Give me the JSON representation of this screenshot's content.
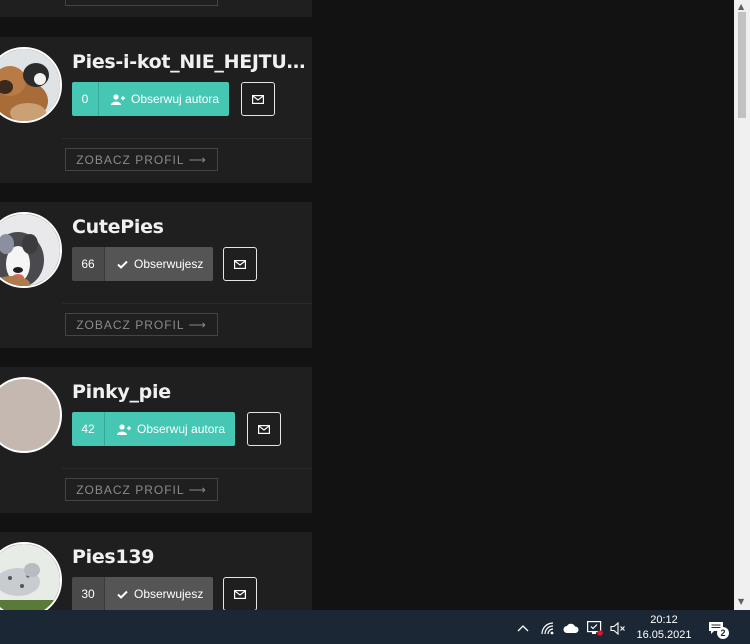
{
  "cards": [
    {
      "name": "Pies-i-kot_NIE_HEJTUJ_...",
      "count": "0",
      "follow_label": "Obserwuj autora",
      "state": "follow",
      "profile_label": "ZOBACZ PROFIL"
    },
    {
      "name": "CutePies",
      "count": "66",
      "follow_label": "Obserwujesz",
      "state": "following",
      "profile_label": "ZOBACZ PROFIL"
    },
    {
      "name": "Pinky_pie",
      "count": "42",
      "follow_label": "Obserwuj autora",
      "state": "follow",
      "profile_label": "ZOBACZ PROFIL"
    },
    {
      "name": "Pies139",
      "count": "30",
      "follow_label": "Obserwujesz",
      "state": "following",
      "profile_label": ""
    }
  ],
  "top_partial": {
    "profile_label": ""
  },
  "taskbar": {
    "time": "20:12",
    "date": "16.05.2021",
    "notification_count": "2",
    "icons": [
      "chevron-up-icon",
      "wifi-icon",
      "cloud-icon",
      "defender-icon",
      "volume-muted-icon",
      "notification-icon"
    ]
  },
  "colors": {
    "accent": "#45c7b4",
    "card_bg": "#1f1f1f",
    "page_bg": "#121212",
    "following_bg": "#555555"
  }
}
